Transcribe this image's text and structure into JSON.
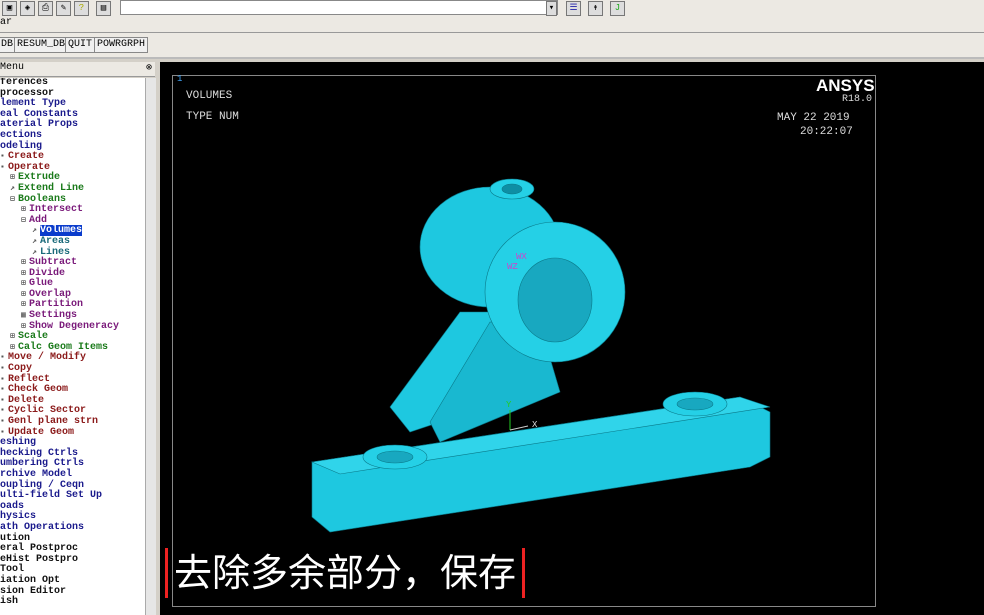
{
  "toolbar": {
    "row2_label": "ar",
    "buttons": [
      "DB",
      "RESUM_DB",
      "QUIT",
      "POWRGRPH"
    ]
  },
  "menu": {
    "title": "Menu",
    "items": [
      {
        "t": "ferences",
        "l": 0,
        "c": "#111"
      },
      {
        "t": "processor",
        "l": 0,
        "c": "#111"
      },
      {
        "t": "lement Type",
        "l": 0,
        "c": "#1a1a8c"
      },
      {
        "t": "eal Constants",
        "l": 0,
        "c": "#1a1a8c"
      },
      {
        "t": "aterial Props",
        "l": 0,
        "c": "#1a1a8c"
      },
      {
        "t": "ections",
        "l": 0,
        "c": "#1a1a8c"
      },
      {
        "t": "odeling",
        "l": 0,
        "c": "#1a1a8c"
      },
      {
        "t": "Create",
        "l": 0,
        "c": "#8b1a1a",
        "i": "▪"
      },
      {
        "t": "Operate",
        "l": 0,
        "c": "#8b1a1a",
        "i": "▪"
      },
      {
        "t": "Extrude",
        "l": 1,
        "c": "#1a7a1a",
        "i": "⊞"
      },
      {
        "t": "Extend Line",
        "l": 1,
        "c": "#1a7a1a",
        "i": "↗"
      },
      {
        "t": "Booleans",
        "l": 1,
        "c": "#1a7a1a",
        "i": "⊟"
      },
      {
        "t": "Intersect",
        "l": 2,
        "c": "#7a1a7a",
        "i": "⊞"
      },
      {
        "t": "Add",
        "l": 2,
        "c": "#7a1a7a",
        "i": "⊟"
      },
      {
        "t": "Volumes",
        "l": 3,
        "c": "#1a6a7a",
        "i": "↗",
        "sel": true
      },
      {
        "t": "Areas",
        "l": 3,
        "c": "#1a6a7a",
        "i": "↗"
      },
      {
        "t": "Lines",
        "l": 3,
        "c": "#1a6a7a",
        "i": "↗"
      },
      {
        "t": "Subtract",
        "l": 2,
        "c": "#7a1a7a",
        "i": "⊞"
      },
      {
        "t": "Divide",
        "l": 2,
        "c": "#7a1a7a",
        "i": "⊞"
      },
      {
        "t": "Glue",
        "l": 2,
        "c": "#7a1a7a",
        "i": "⊞"
      },
      {
        "t": "Overlap",
        "l": 2,
        "c": "#7a1a7a",
        "i": "⊞"
      },
      {
        "t": "Partition",
        "l": 2,
        "c": "#7a1a7a",
        "i": "⊞"
      },
      {
        "t": "Settings",
        "l": 2,
        "c": "#7a1a7a",
        "i": "▦"
      },
      {
        "t": "Show Degeneracy",
        "l": 2,
        "c": "#7a1a7a",
        "i": "⊞"
      },
      {
        "t": "Scale",
        "l": 1,
        "c": "#1a7a1a",
        "i": "⊞"
      },
      {
        "t": "Calc Geom Items",
        "l": 1,
        "c": "#1a7a1a",
        "i": "⊞"
      },
      {
        "t": "Move / Modify",
        "l": 0,
        "c": "#8b1a1a",
        "i": "▪"
      },
      {
        "t": "Copy",
        "l": 0,
        "c": "#8b1a1a",
        "i": "▪"
      },
      {
        "t": "Reflect",
        "l": 0,
        "c": "#8b1a1a",
        "i": "▪"
      },
      {
        "t": "Check Geom",
        "l": 0,
        "c": "#8b1a1a",
        "i": "▪"
      },
      {
        "t": "Delete",
        "l": 0,
        "c": "#8b1a1a",
        "i": "▪"
      },
      {
        "t": "Cyclic Sector",
        "l": 0,
        "c": "#8b1a1a",
        "i": "▪"
      },
      {
        "t": "Genl plane strn",
        "l": 0,
        "c": "#8b1a1a",
        "i": "▪"
      },
      {
        "t": "Update Geom",
        "l": 0,
        "c": "#8b1a1a",
        "i": "▪"
      },
      {
        "t": "eshing",
        "l": 0,
        "c": "#1a1a8c"
      },
      {
        "t": "hecking Ctrls",
        "l": 0,
        "c": "#1a1a8c"
      },
      {
        "t": "umbering Ctrls",
        "l": 0,
        "c": "#1a1a8c"
      },
      {
        "t": "rchive Model",
        "l": 0,
        "c": "#1a1a8c"
      },
      {
        "t": "oupling / Ceqn",
        "l": 0,
        "c": "#1a1a8c"
      },
      {
        "t": "ulti-field Set Up",
        "l": 0,
        "c": "#1a1a8c"
      },
      {
        "t": "oads",
        "l": 0,
        "c": "#1a1a8c"
      },
      {
        "t": "hysics",
        "l": 0,
        "c": "#1a1a8c"
      },
      {
        "t": "ath Operations",
        "l": 0,
        "c": "#1a1a8c"
      },
      {
        "t": "ution",
        "l": 0,
        "c": "#111"
      },
      {
        "t": "eral Postproc",
        "l": 0,
        "c": "#111"
      },
      {
        "t": "eHist Postpro",
        "l": 0,
        "c": "#111"
      },
      {
        "t": " Tool",
        "l": 0,
        "c": "#111"
      },
      {
        "t": "iation Opt",
        "l": 0,
        "c": "#111"
      },
      {
        "t": "sion Editor",
        "l": 0,
        "c": "#111"
      },
      {
        "t": "ish",
        "l": 0,
        "c": "#111"
      }
    ]
  },
  "graphics": {
    "window_num": "1",
    "line1": "VOLUMES",
    "line2": "TYPE NUM",
    "brand": "ANSYS",
    "version": "R18.0",
    "date": "MAY 22 2019",
    "time": "20:22:07",
    "axis_y": "Y",
    "axis_x": "X",
    "wp_x": "WX",
    "wp_z": "WZ"
  },
  "subtitle": "去除多余部分，保存",
  "colors": {
    "model": "#1ec8e0"
  }
}
